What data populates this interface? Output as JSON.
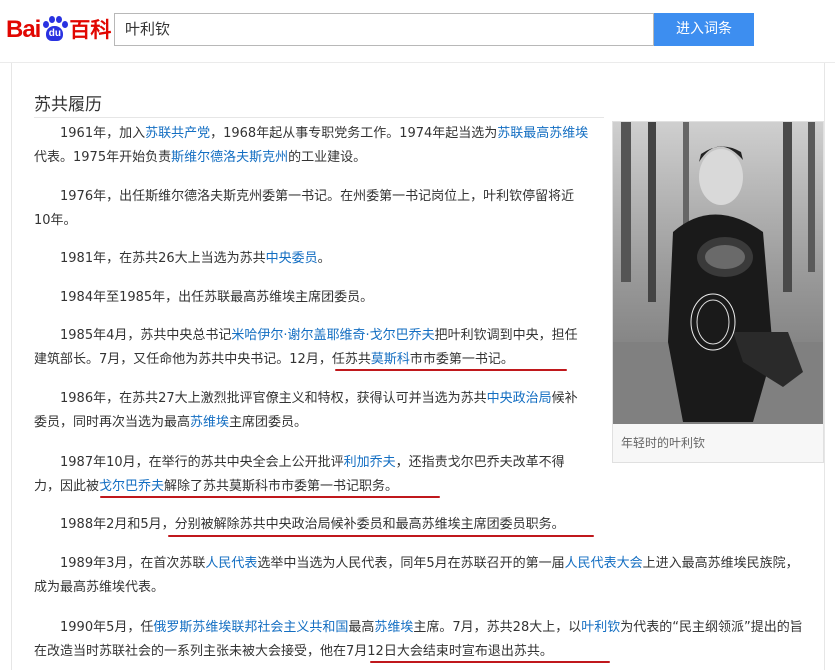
{
  "header": {
    "logo_text_left": "Bai",
    "logo_paw_text": "du",
    "logo_text_right": "百科",
    "search_value": "叶利钦",
    "search_button": "进入词条"
  },
  "section": {
    "title": "苏共履历"
  },
  "paragraphs": [
    [
      "1961年，加入",
      {
        "link": "苏联共产党"
      },
      "，1968年起从事专职党务工作。1974年起当选为",
      {
        "link": "苏联最高苏维埃"
      },
      "代表。1975年开始负责",
      {
        "link": "斯维尔德洛夫斯克州"
      },
      "的工业建设。"
    ],
    [
      "1976年，出任斯维尔德洛夫斯克州委第一书记。在州委第一书记岗位上，叶利钦停留将近10年。"
    ],
    [
      "1981年，在苏共26大上当选为苏共",
      {
        "link": "中央委员"
      },
      "。"
    ],
    [
      "1984年至1985年，出任苏联最高苏维埃主席团委员。"
    ],
    [
      "1985年4月，苏共中央总书记",
      {
        "link": "米哈伊尔·谢尔盖耶维奇·戈尔巴乔夫"
      },
      "把叶利钦调到中央，担任建筑部长。7月，又任命他为苏共中央书记。12月，任苏共",
      {
        "link": "莫斯科"
      },
      "市市委第一书记。"
    ],
    [
      "1986年，在苏共27大上激烈批评官僚主义和特权，获得认可并当选为苏共",
      {
        "link": "中央政治局"
      },
      "候补委员，同时再次当选为最高",
      {
        "link": "苏维埃"
      },
      "主席团委员。"
    ],
    [
      "1987年10月，在举行的苏共中央全会上公开批评",
      {
        "link": "利加乔夫"
      },
      "，还指责戈尔巴乔夫改革不得力，因此被",
      {
        "link": "戈尔巴乔夫"
      },
      "解除了苏共莫斯科市市委第一书记职务。"
    ],
    [
      "1988年2月和5月，分别被解除苏共中央政治局候补委员和最高苏维埃主席团委员职务。"
    ],
    [
      "1989年3月，在首次苏联",
      {
        "link": "人民代表"
      },
      "选举中当选为人民代表，同年5月在苏联召开的第一届",
      {
        "link": "人民代表大会"
      },
      "上进入最高苏维埃民族院，成为最高苏维埃代表。"
    ],
    [
      "1990年5月，任",
      {
        "link": "俄罗斯苏维埃联邦社会主义共和国"
      },
      "最高",
      {
        "link": "苏维埃"
      },
      "主席。7月，苏共28大上，以",
      {
        "link": "叶利钦"
      },
      "为代表的“民主纲领派”提出的旨在改造当时苏联社会的一系列主张未被大会接受，他在7月12日大会结束时宣布退出苏共。"
    ]
  ],
  "figure": {
    "caption": "年轻时的叶利钦"
  },
  "colors": {
    "link": "#136ec2",
    "underline": "#c0181c",
    "button": "#3d8ef0",
    "logo_red": "#e10601",
    "logo_blue": "#2932e1"
  }
}
